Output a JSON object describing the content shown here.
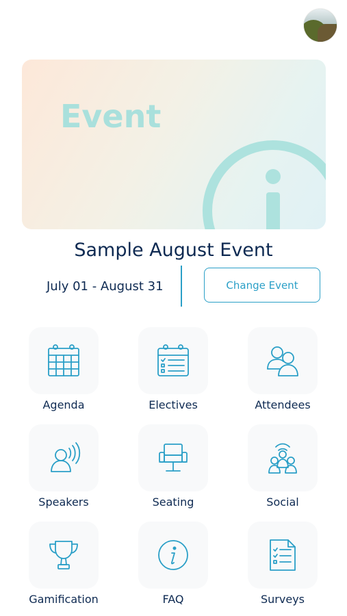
{
  "header": {
    "avatar_icon": "user-avatar-photo"
  },
  "banner": {
    "word": "Event",
    "icon": "info-icon"
  },
  "event": {
    "title": "Sample August Event",
    "dates": "July 01 - August 31",
    "change_label": "Change Event"
  },
  "tiles": [
    {
      "label": "Agenda",
      "icon": "calendar-grid-icon"
    },
    {
      "label": "Electives",
      "icon": "calendar-list-icon"
    },
    {
      "label": "Attendees",
      "icon": "people-icon"
    },
    {
      "label": "Speakers",
      "icon": "speaker-icon"
    },
    {
      "label": "Seating",
      "icon": "seat-icon"
    },
    {
      "label": "Social",
      "icon": "social-icon"
    },
    {
      "label": "Gamification",
      "icon": "trophy-icon"
    },
    {
      "label": "FAQ",
      "icon": "info-circle-icon"
    },
    {
      "label": "Surveys",
      "icon": "survey-icon"
    }
  ],
  "colors": {
    "accent": "#2a9fc7",
    "text": "#0e2a52",
    "banner_word": "#a9e0dc",
    "tile_bg": "#f8f9fa"
  }
}
